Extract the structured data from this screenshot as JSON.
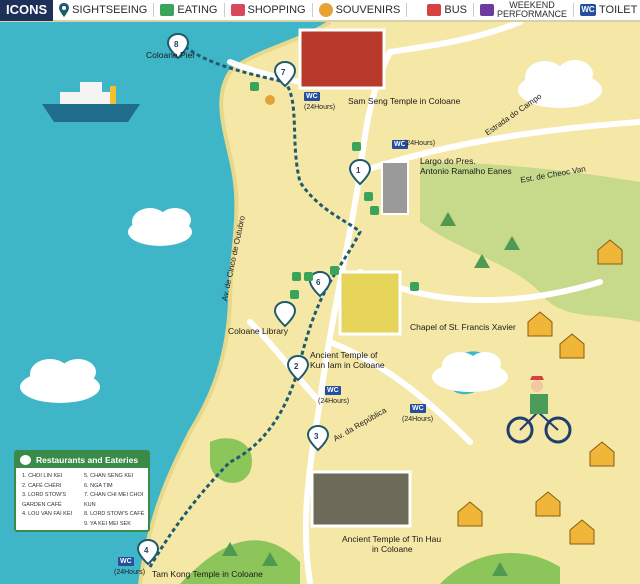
{
  "legend": {
    "title": "ICONS",
    "items": [
      {
        "key": "sightseeing",
        "label": "SIGHTSEEING"
      },
      {
        "key": "eating",
        "label": "EATING"
      },
      {
        "key": "shopping",
        "label": "SHOPPING"
      },
      {
        "key": "souvenirs",
        "label": "SOUVENIRS"
      },
      {
        "key": "bus",
        "label": "BUS"
      },
      {
        "key": "weekend",
        "label_line1": "WEEKEND",
        "label_line2": "PERFORMANCE"
      },
      {
        "key": "toilet",
        "label": "TOILET",
        "icon_text": "WC"
      }
    ],
    "colors": {
      "navy": "#1e2f5a",
      "green": "#3aa45a",
      "red": "#d8475b",
      "orange": "#e6a235",
      "purple": "#6c3aa0",
      "blue": "#254f9e"
    }
  },
  "landmarks": {
    "coloane_pier": "Coloane Pier",
    "sam_seng": "Sam Seng Temple in Coloane",
    "largo_line1": "Largo do Pres.",
    "largo_line2": "Antonio Ramalho Eanes",
    "chapel": "Chapel of St. Francis Xavier",
    "library": "Coloane Library",
    "kun_iam_line1": "Ancient Temple of",
    "kun_iam_line2": "Kun Iam in Coloane",
    "tin_hau_line1": "Ancient Temple of Tin Hau",
    "tin_hau_line2": "in Coloane",
    "tam_kong": "Tam Kong Temple in Coloane"
  },
  "roads": {
    "estrada_campo": "Estrada do Campo",
    "cheoc_van": "Est. de Cheoc Van",
    "cais": "Av. de Cinco de Outubro",
    "republica": "Av. da República"
  },
  "toilets": {
    "label": "WC",
    "hours": "(24Hours)"
  },
  "pins": [
    "1",
    "2",
    "3",
    "4",
    "6",
    "7",
    "8"
  ],
  "restaurants": {
    "title": "Restaurants and Eateries",
    "left": [
      "1. CHOI LIN KEI",
      "2. CAFÉ CHÉRI",
      "3. LORD STOW'S",
      "    GARDEN CAFÉ",
      "4. LOU VAN FAI KEI"
    ],
    "right": [
      "5. CHAN SENG KEI",
      "6. NGA TIM",
      "7. CHAN CHI MEI CHOI KUN",
      "8. LORD STOW'S CAFÉ",
      "9. YA KEI MEI SEK"
    ]
  },
  "colors": {
    "sea": "#3fb6c8",
    "land": "#f5e7a6",
    "road": "#ffffff",
    "route": "#1f5a6e",
    "green": "#8cc55a",
    "pin": "#1f5a6e"
  }
}
